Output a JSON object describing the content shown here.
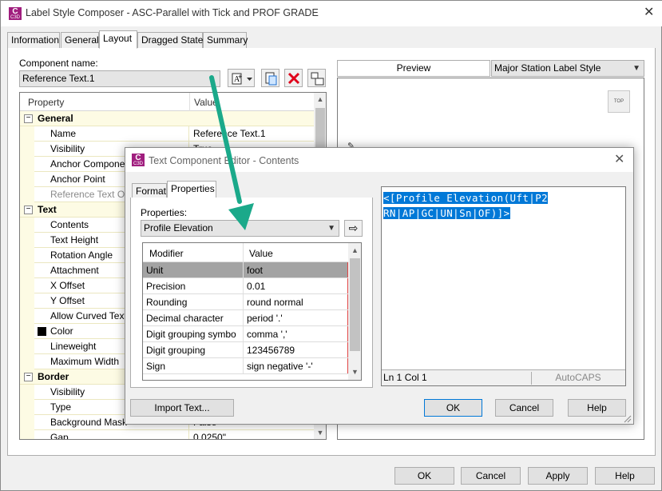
{
  "main": {
    "title": "Label Style Composer - ASC-Parallel with Tick and PROF GRADE",
    "tabs": [
      "Information",
      "General",
      "Layout",
      "Dragged State",
      "Summary"
    ],
    "component_name_label": "Component name:",
    "component_name_value": "Reference Text.1",
    "property_header": "Property",
    "value_header": "Value",
    "sections": [
      {
        "name": "General",
        "rows": [
          {
            "label": "Name",
            "value": "Reference Text.1",
            "dim": false
          },
          {
            "label": "Visibility",
            "value": "True",
            "dim": false
          },
          {
            "label": "Anchor Component",
            "value": "",
            "dim": false
          },
          {
            "label": "Anchor Point",
            "value": "",
            "dim": false
          },
          {
            "label": "Reference Text Object",
            "value": "",
            "dim": true
          }
        ]
      },
      {
        "name": "Text",
        "rows": [
          {
            "label": "Contents",
            "value": "",
            "dim": false
          },
          {
            "label": "Text Height",
            "value": "",
            "dim": false
          },
          {
            "label": "Rotation Angle",
            "value": "",
            "dim": false
          },
          {
            "label": "Attachment",
            "value": "",
            "dim": false
          },
          {
            "label": "X Offset",
            "value": "",
            "dim": false
          },
          {
            "label": "Y Offset",
            "value": "",
            "dim": false
          },
          {
            "label": "Allow Curved Text",
            "value": "",
            "dim": false
          },
          {
            "label": "Color",
            "value": "",
            "dim": false
          },
          {
            "label": "Lineweight",
            "value": "",
            "dim": false
          },
          {
            "label": "Maximum Width",
            "value": "",
            "dim": false
          }
        ]
      },
      {
        "name": "Border",
        "rows": [
          {
            "label": "Visibility",
            "value": "",
            "dim": false
          },
          {
            "label": "Type",
            "value": "",
            "dim": false
          },
          {
            "label": "Background Mask",
            "value": "False",
            "dim": false
          },
          {
            "label": "Gap",
            "value": "0.0250\"",
            "dim": false
          }
        ]
      }
    ],
    "preview_label": "Preview",
    "preview_style": "Major Station Label Style",
    "top_button": "TOP",
    "buttons": {
      "ok": "OK",
      "cancel": "Cancel",
      "apply": "Apply",
      "help": "Help"
    }
  },
  "editor": {
    "title": "Text Component Editor - Contents",
    "tabs": [
      "Format",
      "Properties"
    ],
    "properties_label": "Properties:",
    "property_selected": "Profile Elevation",
    "modifier_header": "Modifier",
    "value_header": "Value",
    "rows": [
      {
        "modifier": "Unit",
        "value": "foot"
      },
      {
        "modifier": "Precision",
        "value": "0.01"
      },
      {
        "modifier": "Rounding",
        "value": "round normal"
      },
      {
        "modifier": "Decimal character",
        "value": "period '.'"
      },
      {
        "modifier": "Digit grouping symbo",
        "value": "comma ','"
      },
      {
        "modifier": "Digit grouping",
        "value": "123456789"
      },
      {
        "modifier": "Sign",
        "value": "sign negative '-'"
      }
    ],
    "text_line1": "<[Profile Elevation(Uft|P2",
    "text_line2": "RN|AP|GC|UN|Sn|OF)]>",
    "status_pos": "Ln 1 Col 1",
    "status_mode": "AutoCAPS",
    "import_button": "Import Text...",
    "ok": "OK",
    "cancel": "Cancel",
    "help": "Help"
  },
  "colors": {
    "accent_arrow": "#1ba98a",
    "selection": "#0078d7",
    "grid_yellow": "#fdfbe4",
    "icon_magenta": "#a01e7e"
  }
}
